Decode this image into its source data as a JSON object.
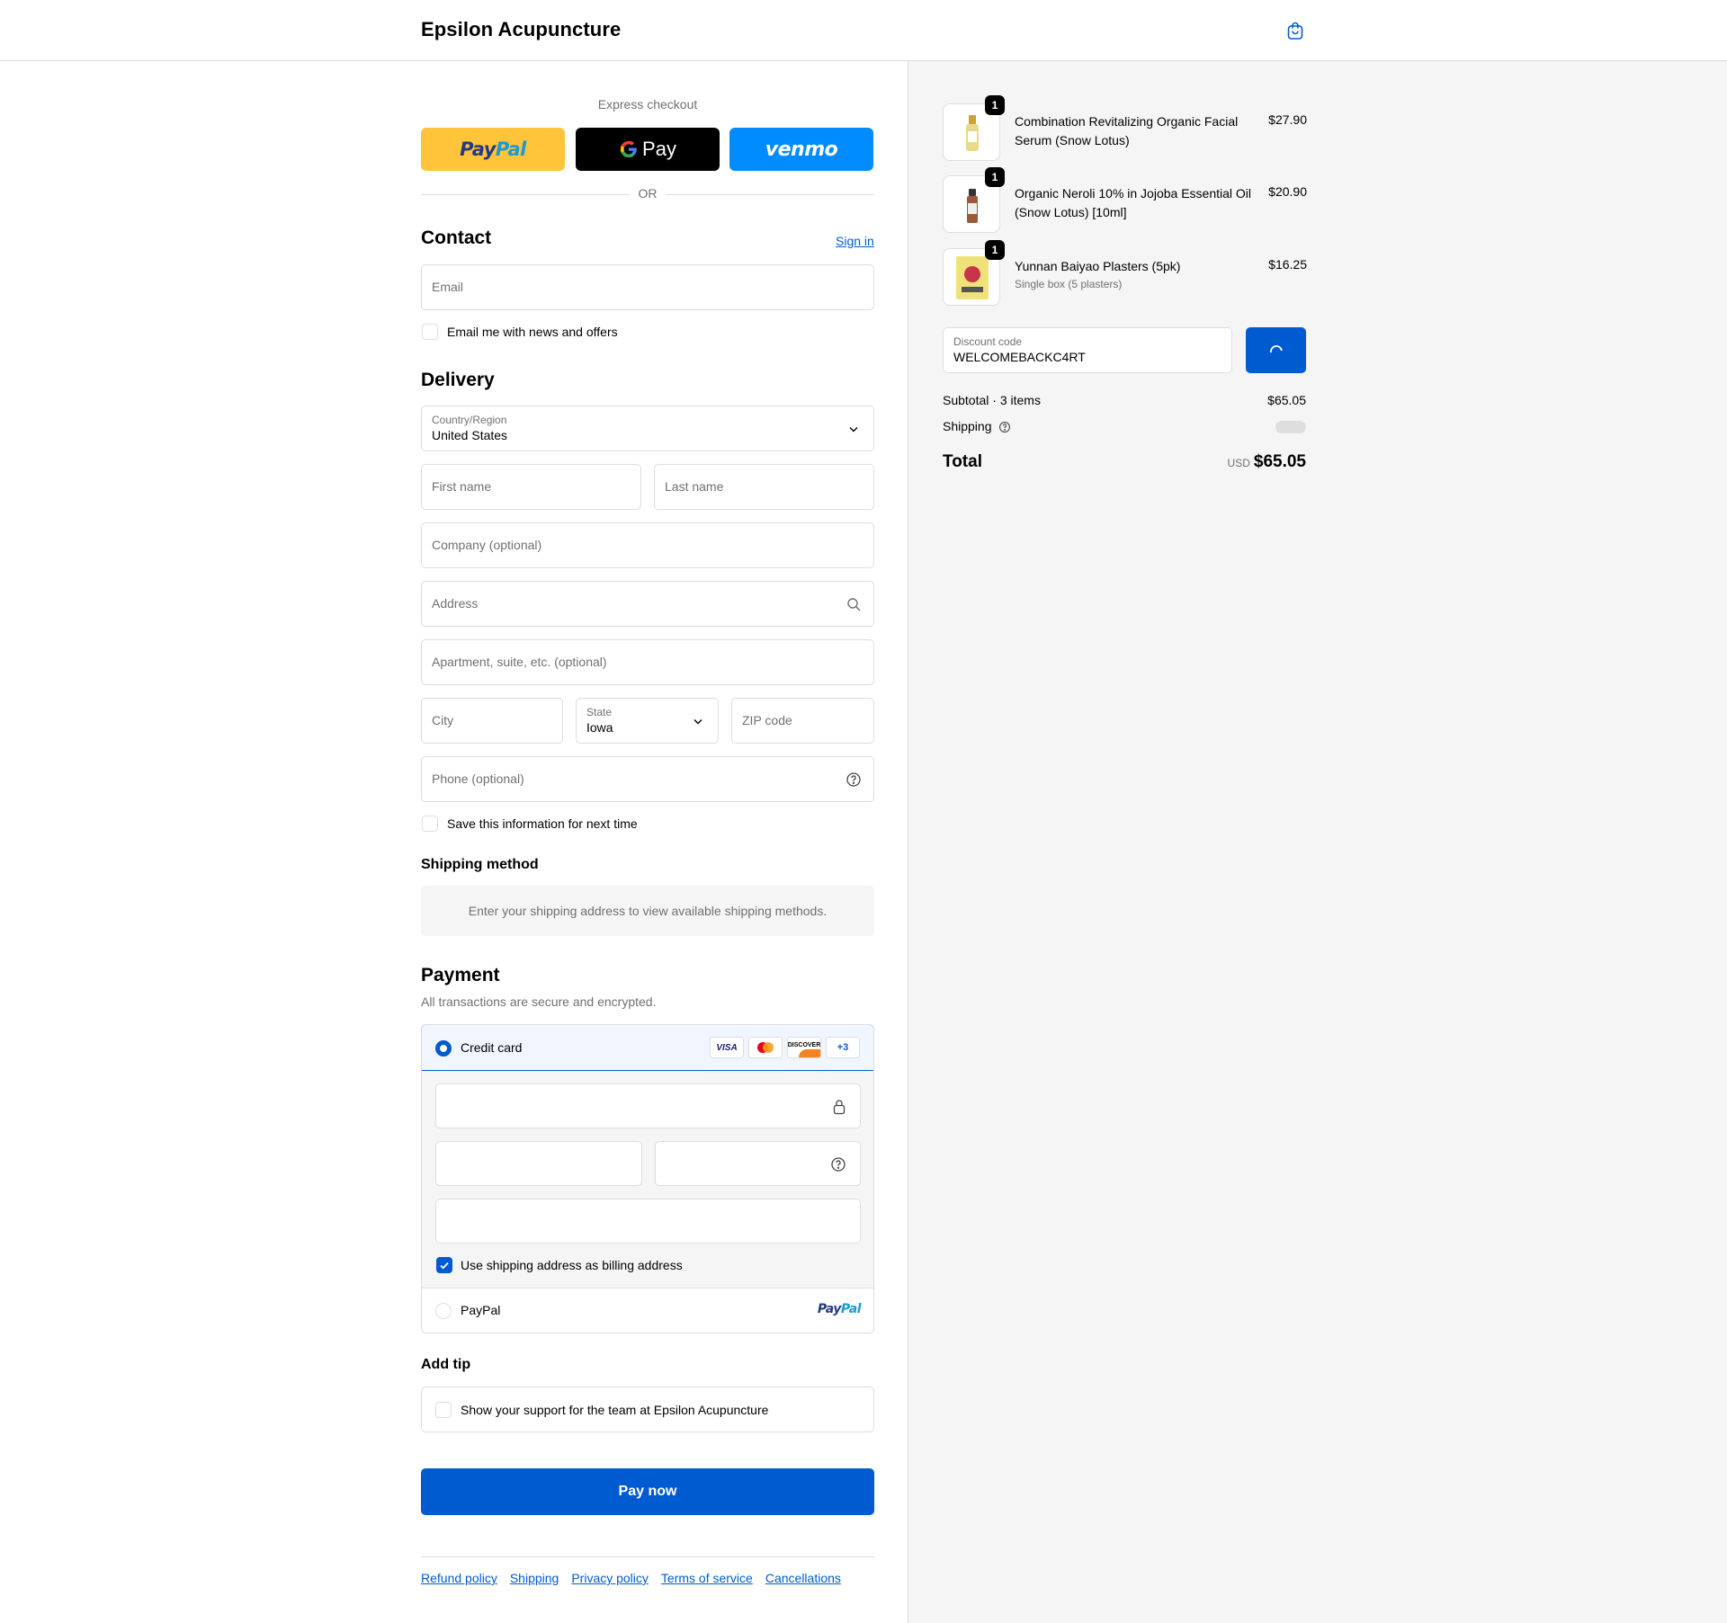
{
  "header": {
    "brand": "Epsilon Acupuncture",
    "cart_icon": "shopping-bag-icon"
  },
  "express": {
    "label": "Express checkout",
    "paypal": {
      "p1": "Pay",
      "p2": "Pal"
    },
    "gpay": "Pay",
    "venmo": "venmo",
    "or": "OR"
  },
  "contact": {
    "title": "Contact",
    "sign_in": "Sign in",
    "email_placeholder": "Email",
    "newsletter": "Email me with news and offers"
  },
  "delivery": {
    "title": "Delivery",
    "country_label": "Country/Region",
    "country_value": "United States",
    "first_name": "First name",
    "last_name": "Last name",
    "company": "Company (optional)",
    "address": "Address",
    "apartment": "Apartment, suite, etc. (optional)",
    "city": "City",
    "state_label": "State",
    "state_value": "Iowa",
    "zip": "ZIP code",
    "phone": "Phone (optional)",
    "save_info": "Save this information for next time"
  },
  "shipping_method": {
    "title": "Shipping method",
    "info": "Enter your shipping address to view available shipping methods."
  },
  "payment": {
    "title": "Payment",
    "subtitle": "All transactions are secure and encrypted.",
    "credit_card": "Credit card",
    "card_brands": [
      "VISA",
      "mastercard",
      "DISCOVER",
      "+3"
    ],
    "billing_same": "Use shipping address as billing address",
    "paypal": "PayPal",
    "paypal_logo": {
      "p1": "Pay",
      "p2": "Pal"
    }
  },
  "tip": {
    "title": "Add tip",
    "label": "Show your support for the team at Epsilon Acupuncture"
  },
  "pay_now": "Pay now",
  "footer": [
    "Refund policy",
    "Shipping",
    "Privacy policy",
    "Terms of service",
    "Cancellations"
  ],
  "order": {
    "items": [
      {
        "name": "Combination Revitalizing Organic Facial Serum (Snow Lotus)",
        "variant": "",
        "qty": "1",
        "price": "$27.90"
      },
      {
        "name": "Organic Neroli 10% in Jojoba Essential Oil (Snow Lotus) [10ml]",
        "variant": "",
        "qty": "1",
        "price": "$20.90"
      },
      {
        "name": "Yunnan Baiyao Plasters (5pk)",
        "variant": "Single box (5 plasters)",
        "qty": "1",
        "price": "$16.25"
      }
    ],
    "discount_label": "Discount code",
    "discount_value": "WELCOMEBACKC4RT",
    "subtotal_label": "Subtotal · 3 items",
    "subtotal_value": "$65.05",
    "shipping_label": "Shipping",
    "total_label": "Total",
    "currency": "USD",
    "total_value": "$65.05"
  },
  "colors": {
    "accent": "#005bd1",
    "paypal": "#ffc439",
    "venmo": "#008cff",
    "panel": "#f5f5f5"
  }
}
